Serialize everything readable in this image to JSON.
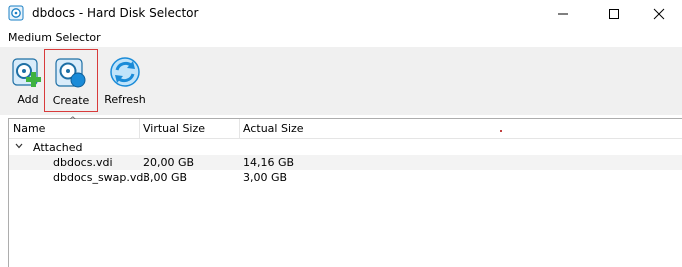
{
  "window": {
    "title": "dbdocs - Hard Disk Selector"
  },
  "group_label": "Medium Selector",
  "toolbar": {
    "add_label": "Add",
    "create_label": "Create",
    "refresh_label": "Refresh"
  },
  "list": {
    "columns": [
      "Name",
      "Virtual Size",
      "Actual Size"
    ],
    "groups": [
      {
        "label": "Attached",
        "items": [
          {
            "name": "dbdocs.vdi",
            "virtual_size": "20,00 GB",
            "actual_size": "14,16 GB"
          },
          {
            "name": "dbdocs_swap.vdi",
            "virtual_size": "3,00 GB",
            "actual_size": "3,00 GB"
          }
        ]
      }
    ]
  },
  "colors": {
    "accent_blue": "#1a8bd8",
    "add_green": "#3fb23f",
    "create_highlight": "#d83b3b"
  },
  "icons": {
    "app": "virtualbox-disk-icon",
    "add": "disk-add-icon",
    "create": "disk-create-icon",
    "refresh": "refresh-icon"
  }
}
